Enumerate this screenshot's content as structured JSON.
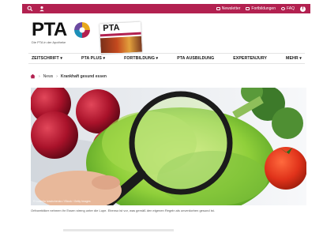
{
  "colors": {
    "accent": "#b22150"
  },
  "topbar": {
    "icons_left": [
      "search-icon",
      "user-icon"
    ],
    "links": [
      {
        "icon": "newsletter-icon",
        "label": "Newsletter"
      },
      {
        "icon": "fortbildungen-icon",
        "label": "Fortbildungen"
      },
      {
        "icon": "faq-icon",
        "label": "FAQ"
      }
    ],
    "social": "facebook-icon"
  },
  "logo": {
    "text": "PTA",
    "subtitle": "Die PTA in der Apotheke"
  },
  "magazine": {
    "title": "PTA"
  },
  "nav": {
    "items": [
      "ZEITSCHRIFT ▾",
      "PTA PLUS ▾",
      "FORTBILDUNG ▾",
      "PTA AUSBILDUNG",
      "EXPERTENJURY",
      "MEHR ▾"
    ]
  },
  "breadcrumb": {
    "home_icon": "home-icon",
    "news": "News",
    "current": "Krankhaft gesund essen"
  },
  "hero": {
    "credit": "© Ludmila Ivashchenko / iStock / Getty Images"
  },
  "caption": "Orthorektiker nehmen ihr Essen streng unter die Lupe. Ebenso ist vor, was gemäß den eigenen Regeln als unverdorben gesund ist."
}
